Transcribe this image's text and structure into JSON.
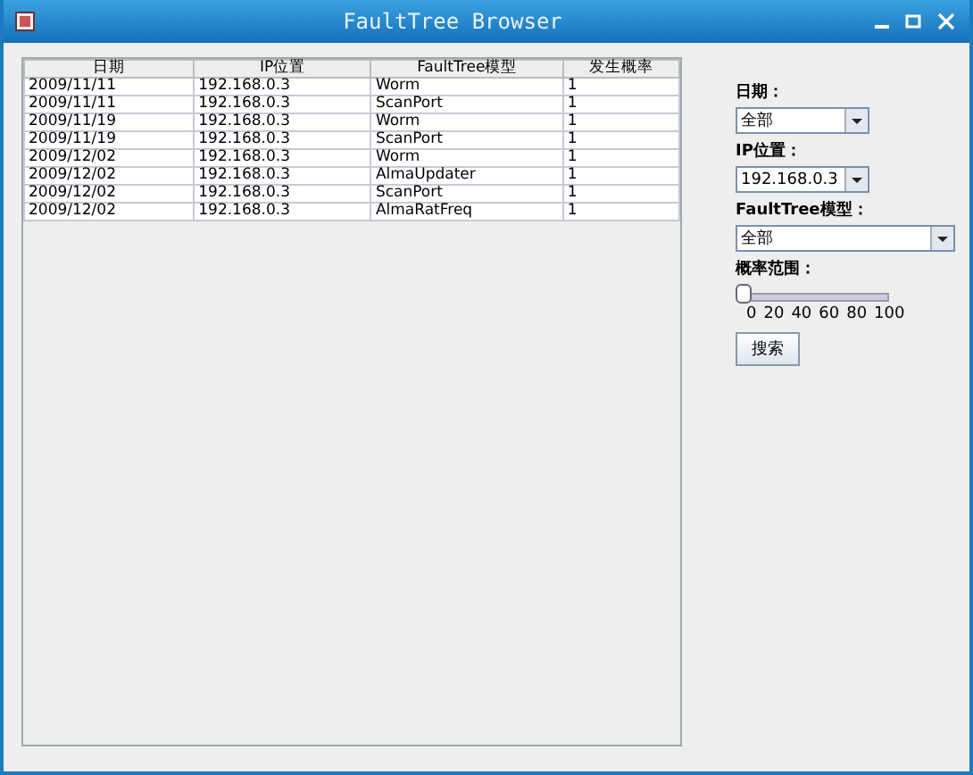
{
  "window": {
    "title": "FaultTree Browser"
  },
  "table": {
    "columns": [
      "日期",
      "IP位置",
      "FaultTree模型",
      "发生概率"
    ],
    "rows": [
      [
        "2009/11/11",
        "192.168.0.3",
        "Worm",
        "1"
      ],
      [
        "2009/11/11",
        "192.168.0.3",
        "ScanPort",
        "1"
      ],
      [
        "2009/11/19",
        "192.168.0.3",
        "Worm",
        "1"
      ],
      [
        "2009/11/19",
        "192.168.0.3",
        "ScanPort",
        "1"
      ],
      [
        "2009/12/02",
        "192.168.0.3",
        "Worm",
        "1"
      ],
      [
        "2009/12/02",
        "192.168.0.3",
        "AlmaUpdater",
        "1"
      ],
      [
        "2009/12/02",
        "192.168.0.3",
        "ScanPort",
        "1"
      ],
      [
        "2009/12/02",
        "192.168.0.3",
        "AlmaRatFreq",
        "1"
      ]
    ]
  },
  "filters": {
    "date_label": "日期：",
    "date_value": "全部",
    "ip_label": "IP位置：",
    "ip_value": "192.168.0.3",
    "model_label": "FaultTree模型：",
    "model_value": "全部",
    "range_label": "概率范围：",
    "slider": {
      "level": 0,
      "ticks": [
        "0",
        "20",
        "40",
        "60",
        "80",
        "100"
      ]
    },
    "search_button": "搜索"
  }
}
